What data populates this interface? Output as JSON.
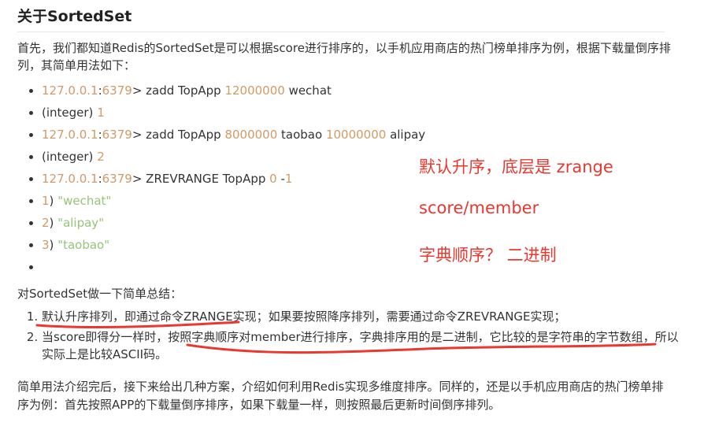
{
  "title": "关于SortedSet",
  "intro": "首先，我们都知道Redis的SortedSet是可以根据score进行排序的，以手机应用商店的热门榜单排序为例，根据下载量倒序排列，其简单用法如下：",
  "code_lines": [
    [
      {
        "t": "127.0.0.1",
        "c": "num"
      },
      {
        "t": ":"
      },
      {
        "t": "6379",
        "c": "num"
      },
      {
        "t": "> zadd TopApp "
      },
      {
        "t": "12000000",
        "c": "num"
      },
      {
        "t": " wechat"
      }
    ],
    [
      {
        "t": "(integer) "
      },
      {
        "t": "1",
        "c": "num"
      }
    ],
    [
      {
        "t": "127.0.0.1",
        "c": "num"
      },
      {
        "t": ":"
      },
      {
        "t": "6379",
        "c": "num"
      },
      {
        "t": "> zadd TopApp "
      },
      {
        "t": "8000000",
        "c": "num"
      },
      {
        "t": " taobao "
      },
      {
        "t": "10000000",
        "c": "num"
      },
      {
        "t": " alipay"
      }
    ],
    [
      {
        "t": "(integer) "
      },
      {
        "t": "2",
        "c": "num"
      }
    ],
    [
      {
        "t": "127.0.0.1",
        "c": "num"
      },
      {
        "t": ":"
      },
      {
        "t": "6379",
        "c": "num"
      },
      {
        "t": "> ZREVRANGE TopApp "
      },
      {
        "t": "0",
        "c": "num"
      },
      {
        "t": " -"
      },
      {
        "t": "1",
        "c": "num"
      }
    ],
    [
      {
        "t": "1",
        "c": "num"
      },
      {
        "t": ") "
      },
      {
        "t": "\"wechat\"",
        "c": "str"
      }
    ],
    [
      {
        "t": "2",
        "c": "num"
      },
      {
        "t": ") "
      },
      {
        "t": "\"alipay\"",
        "c": "str"
      }
    ],
    [
      {
        "t": "3",
        "c": "num"
      },
      {
        "t": ") "
      },
      {
        "t": "\"taobao\"",
        "c": "str"
      }
    ],
    []
  ],
  "summary_title": "对SortedSet做一下简单总结：",
  "summary_items": [
    "默认升序排列，即通过命令ZRANGE实现；如果要按照降序排列，需要通过命令ZREVRANGE实现；",
    "当score即得分一样时，按照字典顺序对member进行排序，字典排序用的是二进制，它比较的是字符串的字节数组，所以实际上是比较ASCII码。"
  ],
  "closing": "简单用法介绍完后，接下来给出几种方案，介绍如何利用Redis实现多维度排序。同样的，还是以手机应用商店的热门榜单排序为例：首先按照APP的下载量倒序排序，如果下载量一样，则按照最后更新时间倒序排列。",
  "notes": [
    "默认升序，底层是 zrange",
    "score/member",
    "字典顺序？ 二进制"
  ],
  "colors": {
    "number": "#d19a66",
    "string": "#98c379",
    "annotation": "#e8382f"
  }
}
